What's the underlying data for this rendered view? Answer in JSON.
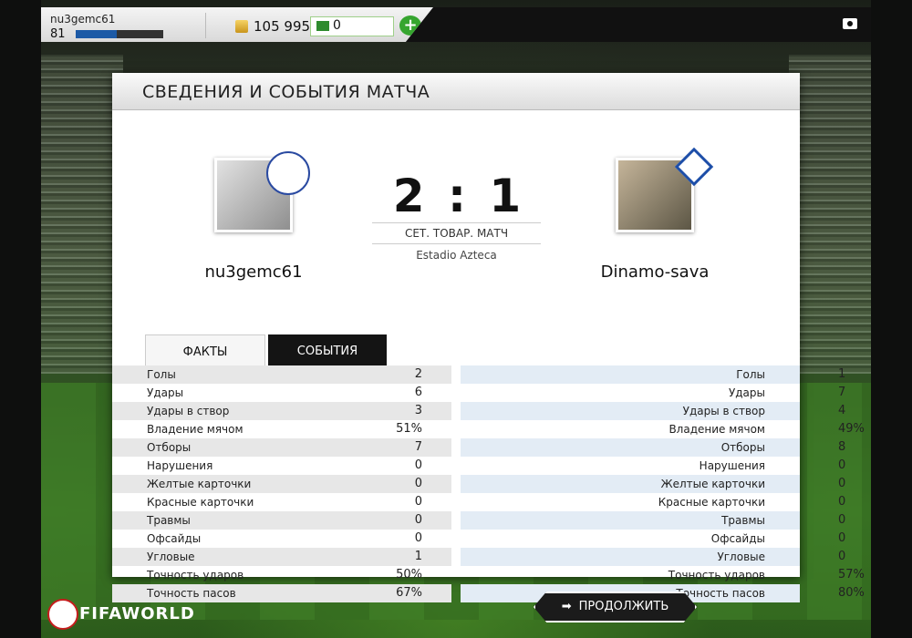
{
  "topbar": {
    "username": "nu3gemc61",
    "level": "81",
    "coins": "105 995",
    "points": "0",
    "add_label": "+",
    "xp_progress": 0.47
  },
  "panel": {
    "title": "СВЕДЕНИЯ И СОБЫТИЯ МАТЧА"
  },
  "match": {
    "home_team": "nu3gemc61",
    "away_team": "Dinamo-sava",
    "score": "2 : 1",
    "type": "СЕТ. ТОВАР. МАТЧ",
    "stadium": "Estadio Azteca"
  },
  "tabs": {
    "facts": "ФАКТЫ",
    "events": "СОБЫТИЯ"
  },
  "stats": [
    {
      "label": "Голы",
      "home": "2",
      "away": "1"
    },
    {
      "label": "Удары",
      "home": "6",
      "away": "7"
    },
    {
      "label": "Удары в створ",
      "home": "3",
      "away": "4"
    },
    {
      "label": "Владение мячом",
      "home": "51%",
      "away": "49%"
    },
    {
      "label": "Отборы",
      "home": "7",
      "away": "8"
    },
    {
      "label": "Нарушения",
      "home": "0",
      "away": "0"
    },
    {
      "label": "Желтые карточки",
      "home": "0",
      "away": "0"
    },
    {
      "label": "Красные карточки",
      "home": "0",
      "away": "0"
    },
    {
      "label": "Травмы",
      "home": "0",
      "away": "0"
    },
    {
      "label": "Офсайды",
      "home": "0",
      "away": "0"
    },
    {
      "label": "Угловые",
      "home": "1",
      "away": "0"
    },
    {
      "label": "Точность ударов",
      "home": "50%",
      "away": "57%"
    },
    {
      "label": "Точность пасов",
      "home": "67%",
      "away": "80%"
    }
  ],
  "footer": {
    "logo": "FIFAWORLD",
    "continue_label": "ПРОДОЛЖИТЬ",
    "arrow_glyph": "➡"
  }
}
